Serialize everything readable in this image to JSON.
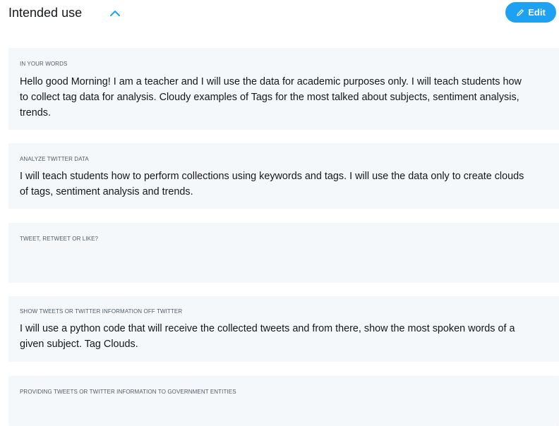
{
  "header": {
    "title": "Intended use",
    "collapse_icon": "chevron-up-icon",
    "edit_label": "Edit",
    "edit_icon": "pencil-icon"
  },
  "sections": [
    {
      "label": "IN YOUR WORDS",
      "body": "Hello good Morning! I am a teacher and I will use the data for academic purposes only. I will teach students how to collect tag data for analysis. Cloudy examples of Tags for the most talked about subjects, sentiment analysis, trends."
    },
    {
      "label": "ANALYZE TWITTER DATA",
      "body": "I will teach students how to perform collections using keywords and tags. I will use the data only to create clouds of tags, sentiment analysis and trends."
    },
    {
      "label": "TWEET, RETWEET OR LIKE?",
      "body": ""
    },
    {
      "label": "SHOW TWEETS OR TWITTER INFORMATION OFF TWITTER",
      "body": "I will use a python code that will receive the collected tweets and from there, show the most spoken words of a given subject. Tag Clouds."
    },
    {
      "label": "PROVIDING TWEETS OR TWITTER INFORMATION TO GOVERNMENT ENTITIES",
      "body": ""
    }
  ],
  "colors": {
    "accent": "#1da1f2",
    "card_background": "#f5f8fa"
  }
}
